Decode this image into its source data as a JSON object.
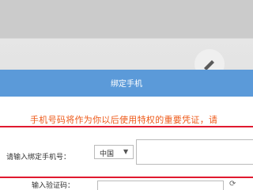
{
  "dialog": {
    "title": "绑定手机",
    "header_color": "#5b9ad9",
    "notice": "手机号码将作为你以后使用特权的重要凭证，请"
  },
  "phone_row": {
    "label": "请输入绑定手机号：",
    "country_selected": "中国",
    "caret": "▼",
    "phone_value": ""
  },
  "code_row": {
    "label": "输入验证码："
  },
  "colors": {
    "notice_text": "#ee5a1a",
    "highlight_line": "#e0192f"
  },
  "icons": {
    "background": "pencil-icon",
    "select": "caret-down-icon",
    "code": "refresh-icon"
  }
}
